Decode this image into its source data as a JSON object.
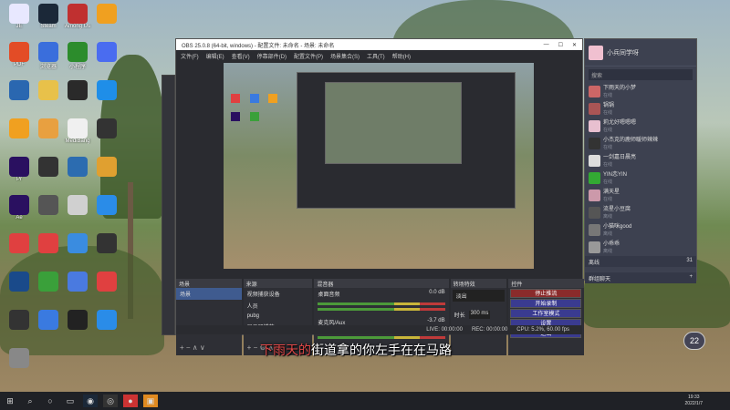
{
  "desktop": {
    "icons": [
      {
        "label": "JE",
        "color": "#e8e8ff"
      },
      {
        "label": "Steam",
        "color": "#1b2838"
      },
      {
        "label": "Among Us",
        "color": "#c03030"
      },
      {
        "label": "",
        "color": "#f0a020"
      },
      {
        "label": "PDF",
        "color": "#e34c26"
      },
      {
        "label": "浏览器",
        "color": "#3a6edc"
      },
      {
        "label": "小程序",
        "color": "#2c8c2c"
      },
      {
        "label": "",
        "color": "#4a6cf0"
      },
      {
        "label": "",
        "color": "#2a67b0"
      },
      {
        "label": "",
        "color": "#e8c14a"
      },
      {
        "label": "",
        "color": "#2a2a2a"
      },
      {
        "label": "",
        "color": "#1f8ee8"
      },
      {
        "label": "",
        "color": "#f0a020"
      },
      {
        "label": "",
        "color": "#e8a040"
      },
      {
        "label": "MediBang",
        "color": "#f0f0f0"
      },
      {
        "label": "",
        "color": "#333"
      },
      {
        "label": "Pr",
        "color": "#2a1060"
      },
      {
        "label": "",
        "color": "#333"
      },
      {
        "label": "",
        "color": "#2c6cb0"
      },
      {
        "label": "",
        "color": "#e0a030"
      },
      {
        "label": "Ae",
        "color": "#2a1060"
      },
      {
        "label": "",
        "color": "#555"
      },
      {
        "label": "",
        "color": "#d0d0d0"
      },
      {
        "label": "",
        "color": "#2a8ce8"
      },
      {
        "label": "",
        "color": "#e04040"
      },
      {
        "label": "",
        "color": "#e04040"
      },
      {
        "label": "",
        "color": "#3a8ce0"
      },
      {
        "label": "",
        "color": "#333"
      },
      {
        "label": "",
        "color": "#1a4a8a"
      },
      {
        "label": "",
        "color": "#3aa03a"
      },
      {
        "label": "",
        "color": "#4a7ae0"
      },
      {
        "label": "",
        "color": "#e04040"
      },
      {
        "label": "",
        "color": "#333"
      },
      {
        "label": "",
        "color": "#3a7ae0"
      },
      {
        "label": "",
        "color": "#222"
      },
      {
        "label": "",
        "color": "#2a8ce8"
      },
      {
        "label": "",
        "color": "#888"
      }
    ]
  },
  "obs": {
    "title": "OBS 25.0.8 (64-bit, windows) - 配置文件: 未命名 - 场景: 未命名",
    "menu": [
      "文件(F)",
      "编辑(E)",
      "查看(V)",
      "停靠部件(D)",
      "配置文件(P)",
      "场景集合(S)",
      "工具(T)",
      "帮助(H)"
    ],
    "panels": {
      "scenes": {
        "title": "场景",
        "items": [
          "场景"
        ]
      },
      "sources": {
        "title": "来源",
        "items": [
          "视频捕获设备",
          "人员",
          "pubg",
          "显示器捕获"
        ]
      },
      "mixer": {
        "title": "混音器",
        "tracks": [
          {
            "name": "桌面音频",
            "db": "0.0 dB"
          },
          {
            "name": "麦克风/Aux",
            "db": "-3.7 dB"
          }
        ]
      },
      "transitions": {
        "title": "转场特效",
        "type": "淡出",
        "duration_label": "时长",
        "duration": "300 ms"
      },
      "controls": {
        "title": "控件",
        "buttons": [
          "停止推流",
          "开始录制",
          "工作室模式",
          "设置",
          "退出"
        ]
      }
    },
    "status": {
      "live": "LIVE: 00:00:00",
      "rec": "REC: 00:00:00",
      "cpu": "CPU: 5.2%, 60.00 fps"
    }
  },
  "chat": {
    "name": "小兵同学呀",
    "search_placeholder": "搜索",
    "contacts": [
      {
        "name": "下雨天的小梦",
        "status": "在线",
        "color": "#c66"
      },
      {
        "name": "锅锅",
        "status": "在线",
        "color": "#a55"
      },
      {
        "name": "莉尤好嗯嗯嗯",
        "status": "在线",
        "color": "#e8c0d0"
      },
      {
        "name": "小杰克的鹿师暖师辣辣",
        "status": "在线",
        "color": "#333"
      },
      {
        "name": "一剑嘉日晨亮",
        "status": "在线",
        "color": "#ddd"
      },
      {
        "name": "YIN恋YIN",
        "status": "在线",
        "color": "#3a3"
      },
      {
        "name": "满天星",
        "status": "在线",
        "color": "#c9a"
      },
      {
        "name": "流星小豆腐",
        "status": "离线",
        "color": "#555"
      },
      {
        "name": "小猫咪good",
        "status": "离线",
        "color": "#777"
      },
      {
        "name": "小乖乖",
        "status": "离线",
        "color": "#999"
      }
    ],
    "section_label": "离线",
    "section_count": "31",
    "group_label": "群组聊天"
  },
  "subtitle": {
    "highlight": "下雨天的",
    "rest": "街道拿的你左手在在马路"
  },
  "weather_badge": "22",
  "taskbar": {
    "time": "19:33",
    "date": "2022/1/7"
  }
}
